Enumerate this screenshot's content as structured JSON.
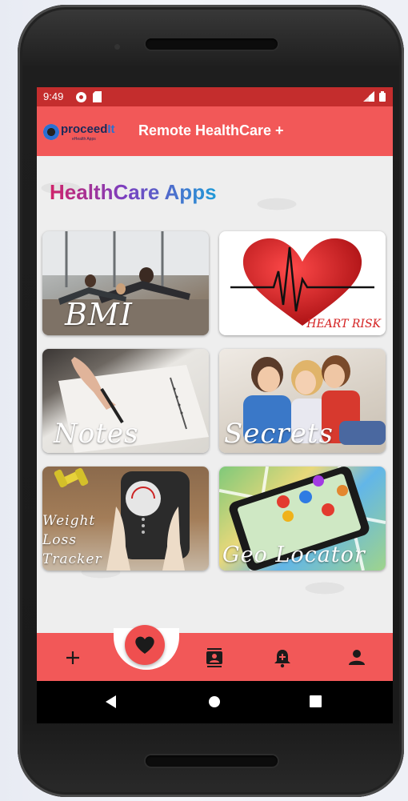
{
  "status_bar": {
    "time": "9:49"
  },
  "app_bar": {
    "logo_text_pre": "proceed",
    "logo_text_accent": "It",
    "logo_tagline": "eHealth Apps",
    "title": "Remote HealthCare +"
  },
  "main": {
    "heading": "HealthCare Apps",
    "tiles": [
      {
        "id": "bmi",
        "label": "BMI"
      },
      {
        "id": "heart-risk",
        "label": "HEART RISK"
      },
      {
        "id": "notes",
        "label": "Notes"
      },
      {
        "id": "secrets",
        "label": "Secrets"
      },
      {
        "id": "weight-loss-tracker",
        "label_lines": [
          "Weight",
          "Loss",
          "Tracker"
        ]
      },
      {
        "id": "geo-locator",
        "label": "Geo Locator"
      }
    ]
  },
  "bottom_nav": {
    "items": [
      "plus-icon",
      "heart-icon",
      "contacts-icon",
      "bell-plus-icon",
      "person-icon"
    ],
    "selected": "heart-icon"
  },
  "system_nav": {
    "items": [
      "back-icon",
      "home-icon",
      "recents-icon"
    ]
  },
  "colors": {
    "accent": "#f25858",
    "status_bar": "#c42d2d",
    "heading_start": "#d0246a",
    "heading_end": "#1f9bd8"
  }
}
